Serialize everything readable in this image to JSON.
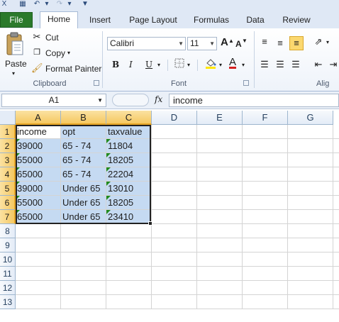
{
  "ribbon": {
    "tabs": [
      "File",
      "Home",
      "Insert",
      "Page Layout",
      "Formulas",
      "Data",
      "Review"
    ],
    "active_tab": "Home",
    "clipboard": {
      "group_label": "Clipboard",
      "paste_label": "Paste",
      "cut_label": "Cut",
      "copy_label": "Copy",
      "format_painter_label": "Format Painter"
    },
    "font": {
      "group_label": "Font",
      "font_name": "Calibri",
      "font_size": "11",
      "bold_label": "B",
      "italic_label": "I",
      "underline_label": "U",
      "grow_label": "A",
      "shrink_label": "A",
      "font_color_label": "A"
    },
    "alignment": {
      "group_label": "Alig"
    }
  },
  "formula_bar": {
    "name_box": "A1",
    "fx_label": "fx",
    "formula": "income"
  },
  "sheet": {
    "columns": [
      "A",
      "B",
      "C",
      "D",
      "E",
      "F",
      "G"
    ],
    "rows": [
      "1",
      "2",
      "3",
      "4",
      "5",
      "6",
      "7",
      "8",
      "9",
      "10",
      "11",
      "12",
      "13"
    ],
    "cells": [
      [
        "income",
        "opt",
        "taxvalue"
      ],
      [
        "39000",
        "65 - 74",
        "11804"
      ],
      [
        "55000",
        "65 - 74",
        "18205"
      ],
      [
        "65000",
        "65 - 74",
        "22204"
      ],
      [
        "39000",
        "Under 65",
        "13010"
      ],
      [
        "55000",
        "Under 65",
        "18205"
      ],
      [
        "65000",
        "Under 65",
        "23410"
      ]
    ],
    "selection": "A1:C7"
  },
  "icons": {
    "save": "save-icon",
    "undo": "undo-icon",
    "redo": "redo-icon",
    "paste": "paste-icon",
    "cut": "scissors-icon",
    "copy": "copy-icon",
    "painter": "paintbrush-icon",
    "borders": "borders-icon",
    "fill": "fill-color-icon"
  },
  "colors": {
    "file_tab": "#2b7a2b",
    "selection_fill": "#c5daf2",
    "header_highlight": "#f5c861",
    "error_triangle": "#1f8a1f",
    "font_color_red": "#d42020",
    "fill_yellow": "#ffe600"
  }
}
